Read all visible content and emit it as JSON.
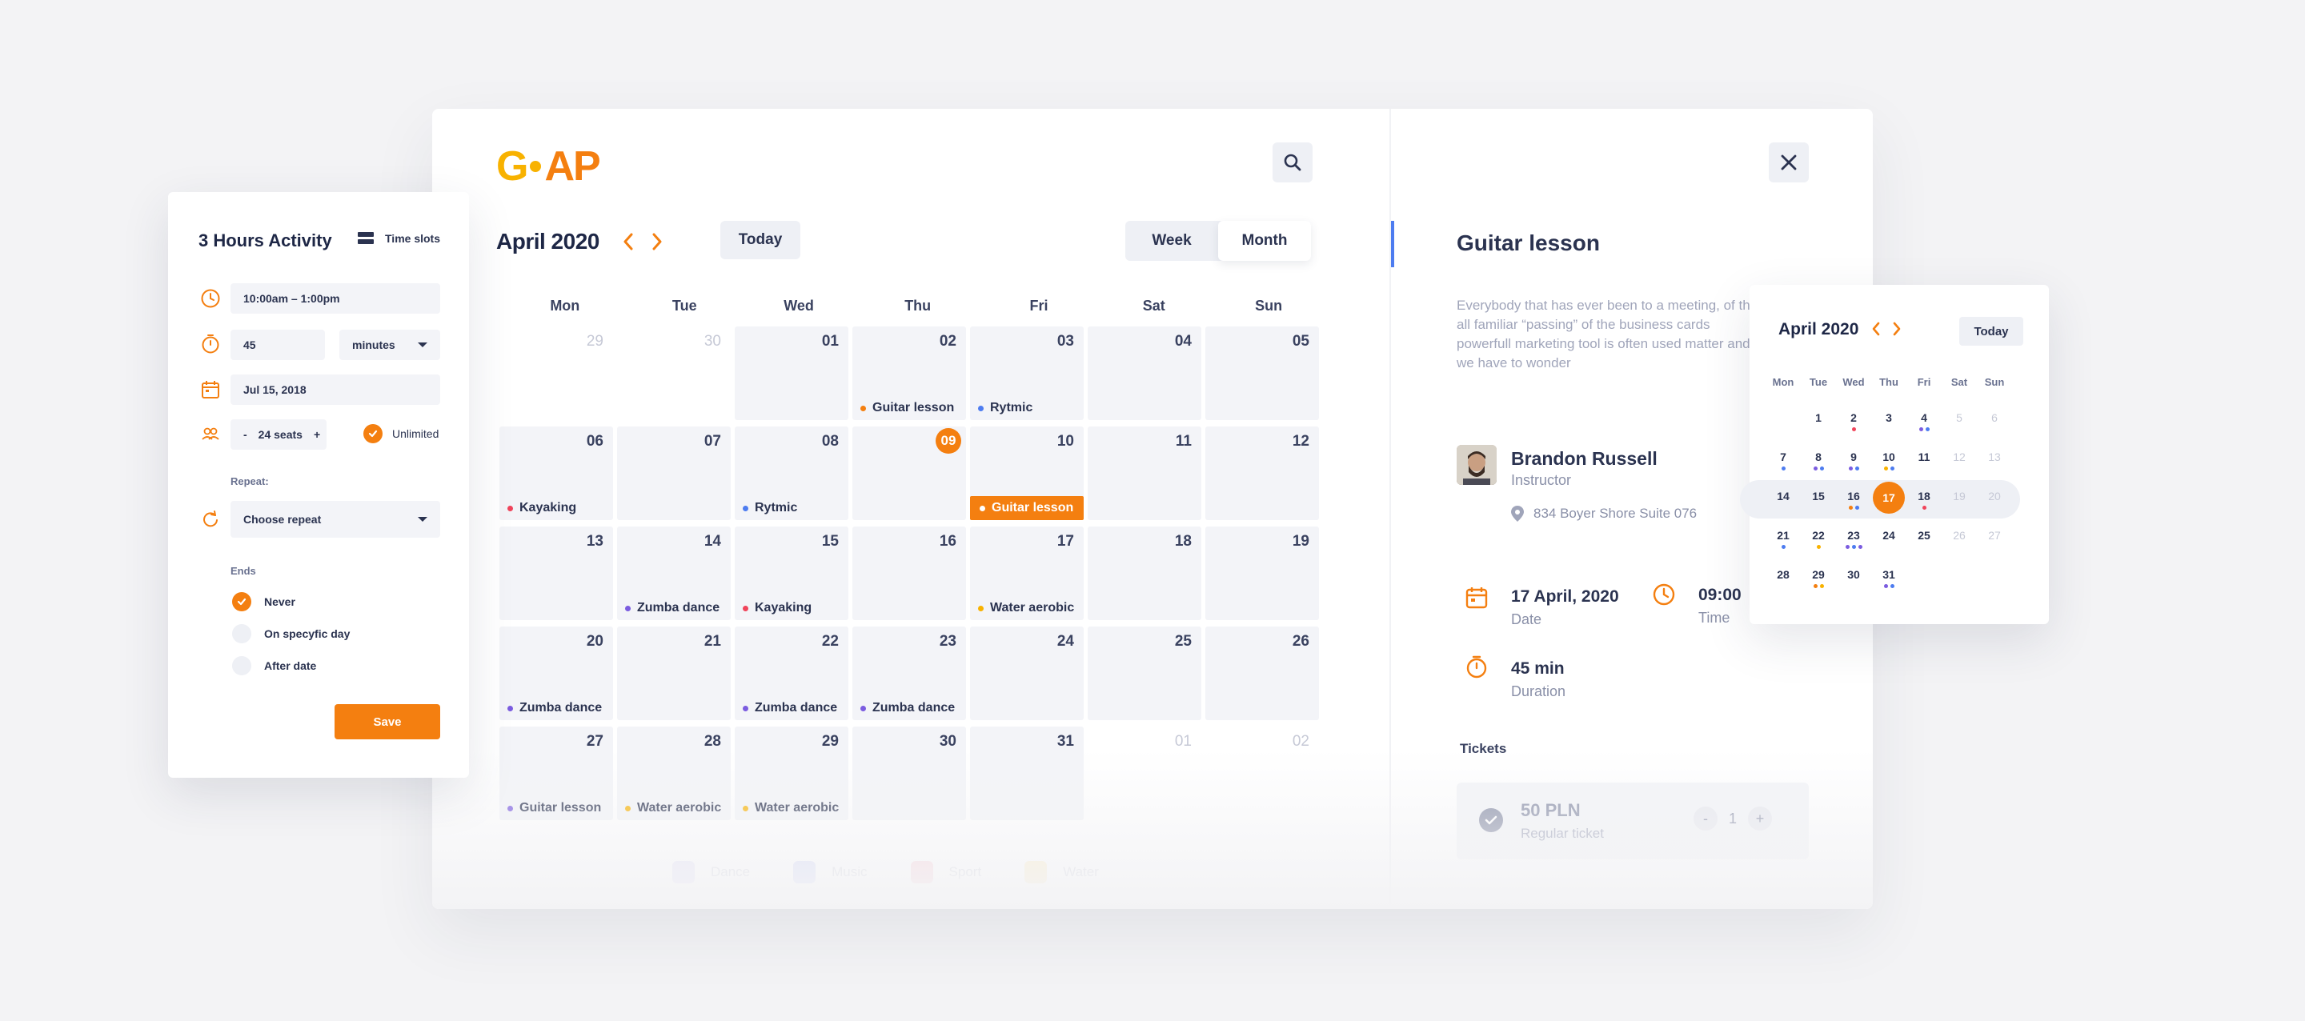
{
  "logo": {
    "text_g": "G",
    "text_ap": "AP"
  },
  "calendar": {
    "month_title": "April 2020",
    "today_label": "Today",
    "view_week": "Week",
    "view_month": "Month",
    "days_of_week": [
      "Mon",
      "Tue",
      "Wed",
      "Thu",
      "Fri",
      "Sat",
      "Sun"
    ],
    "cells": [
      {
        "n": "29",
        "muted": true
      },
      {
        "n": "30",
        "muted": true
      },
      {
        "n": "01"
      },
      {
        "n": "02",
        "ev": "Guitar lesson",
        "c": "#f47f10"
      },
      {
        "n": "03",
        "ev": "Rytmic",
        "c": "#4d7cf0"
      },
      {
        "n": "04"
      },
      {
        "n": "05"
      },
      {
        "n": "06",
        "ev": "Kayaking",
        "c": "#f0445b"
      },
      {
        "n": "07"
      },
      {
        "n": "08",
        "ev": "Rytmic",
        "c": "#4d7cf0"
      },
      {
        "n": "09",
        "today": true
      },
      {
        "n": "10",
        "ev": "Guitar lesson",
        "c": "#f47f10",
        "hl": true
      },
      {
        "n": "11"
      },
      {
        "n": "12"
      },
      {
        "n": "13"
      },
      {
        "n": "14",
        "ev": "Zumba dance",
        "c": "#7b5ce0"
      },
      {
        "n": "15",
        "ev": "Kayaking",
        "c": "#f0445b"
      },
      {
        "n": "16"
      },
      {
        "n": "17",
        "ev": "Water aerobic",
        "c": "#f8b200"
      },
      {
        "n": "18"
      },
      {
        "n": "19"
      },
      {
        "n": "20",
        "ev": "Zumba dance",
        "c": "#7b5ce0"
      },
      {
        "n": "21"
      },
      {
        "n": "22",
        "ev": "Zumba dance",
        "c": "#7b5ce0"
      },
      {
        "n": "23",
        "ev": "Zumba dance",
        "c": "#7b5ce0"
      },
      {
        "n": "24"
      },
      {
        "n": "25"
      },
      {
        "n": "26"
      },
      {
        "n": "27",
        "ev": "Guitar lesson",
        "c": "#7b5ce0"
      },
      {
        "n": "28",
        "ev": "Water aerobic",
        "c": "#f8b200"
      },
      {
        "n": "29",
        "ev": "Water aerobic",
        "c": "#f8b200"
      },
      {
        "n": "30"
      },
      {
        "n": "31"
      },
      {
        "n": "01",
        "muted": true
      },
      {
        "n": "02",
        "muted": true
      }
    ],
    "legend": [
      {
        "label": "Dance",
        "color": "#b9b3f0"
      },
      {
        "label": "Music",
        "color": "#8f9cf0"
      },
      {
        "label": "Sport",
        "color": "#f38aa0"
      },
      {
        "label": "Water",
        "color": "#f8d06a"
      }
    ]
  },
  "event": {
    "title": "Guitar lesson",
    "description": "Everybody that has ever been to a meeting, of the all familiar “passing” of the business cards powerfull marketing tool is often used matter and we have to wonder",
    "instructor_name": "Brandon Russell",
    "instructor_role": "Instructor",
    "address": "834 Boyer Shore Suite 076",
    "date_value": "17 April, 2020",
    "date_label": "Date",
    "time_value": "09:00",
    "time_label": "Time",
    "duration_value": "45 min",
    "duration_label": "Duration",
    "tickets_heading": "Tickets",
    "ticket_price": "50 PLN",
    "ticket_type": "Regular ticket",
    "ticket_qty": "1",
    "qty_minus": "-",
    "qty_plus": "+"
  },
  "mini_calendar": {
    "title": "April 2020",
    "today_label": "Today",
    "days_of_week": [
      "Mon",
      "Tue",
      "Wed",
      "Thu",
      "Fri",
      "Sat",
      "Sun"
    ],
    "days": [
      {
        "n": ""
      },
      {
        "n": "1"
      },
      {
        "n": "2",
        "dots": [
          "#f0445b"
        ]
      },
      {
        "n": "3"
      },
      {
        "n": "4",
        "dots": [
          "#7b5ce0",
          "#4d7cf0"
        ]
      },
      {
        "n": "5",
        "m": true
      },
      {
        "n": "6",
        "m": true
      },
      {
        "n": "7",
        "dots": [
          "#4d7cf0"
        ]
      },
      {
        "n": "8",
        "dots": [
          "#7b5ce0",
          "#4d7cf0"
        ]
      },
      {
        "n": "9",
        "dots": [
          "#7b5ce0",
          "#4d7cf0"
        ]
      },
      {
        "n": "10",
        "dots": [
          "#f8b200",
          "#4d7cf0"
        ]
      },
      {
        "n": "11"
      },
      {
        "n": "12",
        "m": true
      },
      {
        "n": "13",
        "m": true
      },
      {
        "n": "14"
      },
      {
        "n": "15"
      },
      {
        "n": "16",
        "dots": [
          "#f47f10",
          "#4d7cf0"
        ]
      },
      {
        "n": "17",
        "sel": true
      },
      {
        "n": "18",
        "dots": [
          "#f0445b"
        ]
      },
      {
        "n": "19",
        "m": true
      },
      {
        "n": "20",
        "m": true
      },
      {
        "n": "21",
        "dots": [
          "#4d7cf0"
        ]
      },
      {
        "n": "22",
        "dots": [
          "#f8b200"
        ]
      },
      {
        "n": "23",
        "dots": [
          "#7b5ce0",
          "#4d7cf0",
          "#7b5ce0"
        ]
      },
      {
        "n": "24"
      },
      {
        "n": "25"
      },
      {
        "n": "26",
        "m": true
      },
      {
        "n": "27",
        "m": true
      },
      {
        "n": "28"
      },
      {
        "n": "29",
        "dots": [
          "#f47f10",
          "#f8b200"
        ]
      },
      {
        "n": "30"
      },
      {
        "n": "31",
        "dots": [
          "#7b5ce0",
          "#4d7cf0"
        ]
      },
      {
        "n": ""
      },
      {
        "n": ""
      },
      {
        "n": ""
      }
    ]
  },
  "activity": {
    "title": "3 Hours Activity",
    "time_slots_label": "Time slots",
    "time_range": "10:00am – 1:00pm",
    "duration_value": "45",
    "duration_unit": "minutes",
    "date": "Jul 15, 2018",
    "seats_minus": "-",
    "seats_value": "24 seats",
    "seats_plus": "+",
    "unlimited_label": "Unlimited",
    "repeat_label": "Repeat:",
    "repeat_select": "Choose repeat",
    "ends_label": "Ends",
    "end_options": [
      "Never",
      "On specyfic day",
      "After date"
    ],
    "save_label": "Save"
  },
  "colors": {
    "accent": "#f47f10",
    "accent_yellow": "#f8b200",
    "blue": "#4d7cf0",
    "ink": "#2b3350"
  }
}
